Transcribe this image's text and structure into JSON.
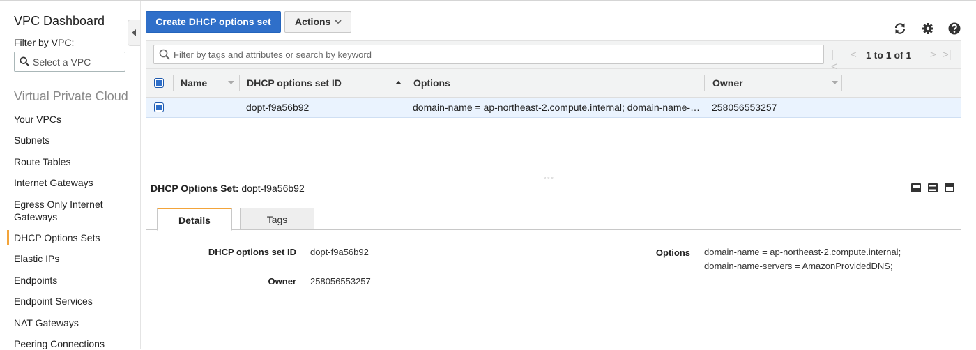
{
  "sidebar": {
    "title": "VPC Dashboard",
    "filter_label": "Filter by VPC:",
    "select_placeholder": "Select a VPC",
    "section": "Virtual Private Cloud",
    "items": [
      {
        "label": "Your VPCs"
      },
      {
        "label": "Subnets"
      },
      {
        "label": "Route Tables"
      },
      {
        "label": "Internet Gateways"
      },
      {
        "label": "Egress Only Internet Gateways"
      },
      {
        "label": "DHCP Options Sets"
      },
      {
        "label": "Elastic IPs"
      },
      {
        "label": "Endpoints"
      },
      {
        "label": "Endpoint Services"
      },
      {
        "label": "NAT Gateways"
      },
      {
        "label": "Peering Connections"
      }
    ],
    "active_item": "DHCP Options Sets"
  },
  "toolbar": {
    "create_label": "Create DHCP options set",
    "actions_label": "Actions",
    "icons": [
      "refresh-icon",
      "gear-icon",
      "help-icon"
    ]
  },
  "grid": {
    "search_placeholder": "Filter by tags and attributes or search by keyword",
    "pager_text": "1 to 1 of 1",
    "columns": [
      "Name",
      "DHCP options set ID",
      "Options",
      "Owner"
    ],
    "rows": [
      {
        "name": "",
        "id": "dopt-f9a56b92",
        "options": "domain-name = ap-northeast-2.compute.internal; domain-name-…",
        "owner": "258056553257",
        "selected": true
      }
    ]
  },
  "detail": {
    "title_label": "DHCP Options Set:",
    "title_value": "dopt-f9a56b92",
    "tabs": [
      "Details",
      "Tags"
    ],
    "active_tab": "Details",
    "fields": {
      "id_label": "DHCP options set ID",
      "id_value": "dopt-f9a56b92",
      "owner_label": "Owner",
      "owner_value": "258056553257",
      "options_label": "Options",
      "options_line1": "domain-name = ap-northeast-2.compute.internal;",
      "options_line2": "domain-name-servers = AmazonProvidedDNS;"
    }
  },
  "colors": {
    "primary": "#2f6fc9",
    "accent": "#f3a43a",
    "selected_row": "#eaf3fe"
  }
}
